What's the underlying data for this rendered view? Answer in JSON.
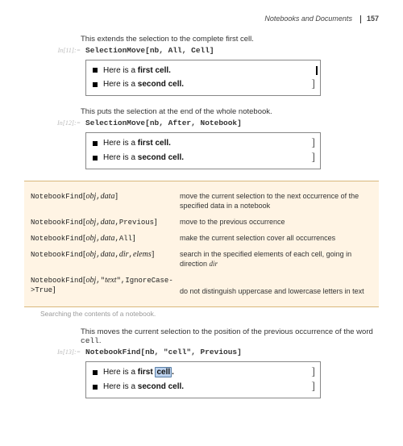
{
  "header": {
    "section": "Notebooks and Documents",
    "page": "157"
  },
  "block1": {
    "narration": "This extends the selection to the complete first cell.",
    "in_label": "In[11]:=",
    "code": "SelectionMove[nb, All, Cell]",
    "cell1_prefix": "Here is a ",
    "cell1_bold": "first cell.",
    "cell2_prefix": "Here is a ",
    "cell2_bold": "second cell."
  },
  "block2": {
    "narration": "This puts the selection at the end of the whole notebook.",
    "in_label": "In[12]:=",
    "code": "SelectionMove[nb, After, Notebook]",
    "cell1_prefix": "Here is a ",
    "cell1_bold": "first cell.",
    "cell2_prefix": "Here is a ",
    "cell2_bold": "second cell."
  },
  "reftable": {
    "rows": [
      {
        "fn": "NotebookFind",
        "args_html": "<span class='br'>[</span><span class='args'>obj</span>,<span class='args'>data</span><span class='br'>]</span>",
        "desc": "move the current selection to the next occurrence of the specified data in a notebook"
      },
      {
        "fn": "NotebookFind",
        "args_html": "<span class='br'>[</span><span class='args'>obj</span>,<span class='args'>data</span>,Previous<span class='br'>]</span>",
        "desc": "move to the previous occurrence"
      },
      {
        "fn": "NotebookFind",
        "args_html": "<span class='br'>[</span><span class='args'>obj</span>,<span class='args'>data</span>,All<span class='br'>]</span>",
        "desc": "make the current selection cover all occurrences"
      },
      {
        "fn": "NotebookFind",
        "args_html": "<span class='br'>[</span><span class='args'>obj</span>,<span class='args'>data</span>,<span class='args'>dir</span>,<span class='args'>elems</span><span class='br'>]</span>",
        "desc": "search in the specified elements of each cell, going in direction <span class='dir'>dir</span>"
      },
      {
        "fn": "NotebookFind",
        "args_html": "<span class='br'>[</span><span class='args'>obj</span>,\"<span class='args'>text</span>\",IgnoreCase-&gt;True<span class='br'>]</span>",
        "desc": "do not distinguish uppercase and lowercase letters in text",
        "desc_offset": true
      }
    ],
    "caption": "Searching the contents of a notebook."
  },
  "block3": {
    "narration_pre": "This moves the current selection to the position of the previous occurrence of the word ",
    "narration_code": "cell",
    "narration_post": ".",
    "in_label": "In[13]:=",
    "code": "NotebookFind[nb, \"cell\", Previous]",
    "cell1_prefix": "Here is a ",
    "cell1_bold_pre": "first ",
    "cell1_sel": "cell",
    "cell1_bold_post": ".",
    "cell2_prefix": "Here is a ",
    "cell2_bold": "second cell."
  }
}
